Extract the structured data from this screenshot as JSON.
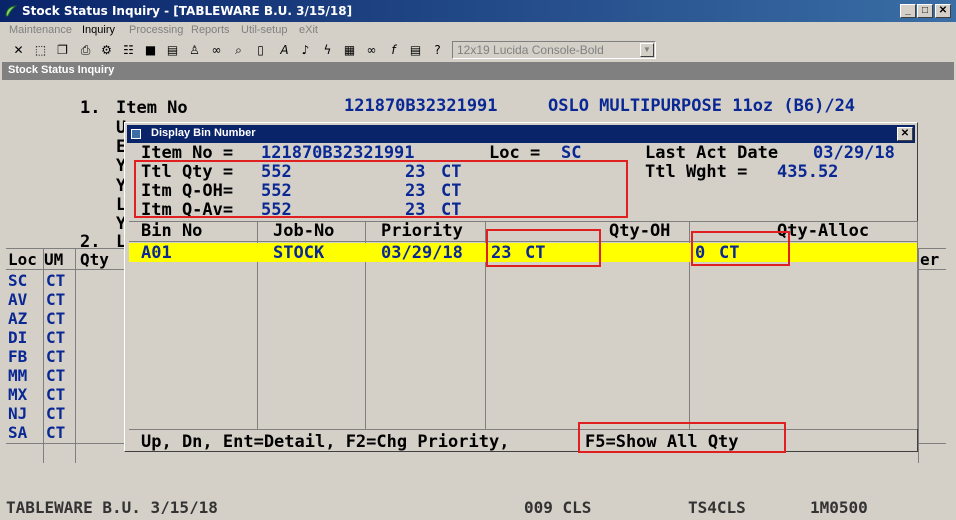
{
  "window": {
    "title": "Stock Status Inquiry - [TABLEWARE B.U. 3/15/18]",
    "minimize": "_",
    "maximize": "□",
    "close": "✕"
  },
  "menu": {
    "items": [
      {
        "label": "Maintenance",
        "enabled": false
      },
      {
        "label": "Inquiry",
        "enabled": true
      },
      {
        "label": "Processing",
        "enabled": false
      },
      {
        "label": "Reports",
        "enabled": false
      },
      {
        "label": "Util-setup",
        "enabled": false
      },
      {
        "label": "eXit",
        "enabled": false
      }
    ]
  },
  "toolbar": {
    "icons": [
      "close-icon",
      "select-icon",
      "copy-icon",
      "print-icon",
      "settings-icon",
      "options-icon",
      "stop-icon",
      "report-icon",
      "user-icon",
      "binoculars-icon",
      "search-icon",
      "bookmark-icon",
      "font-icon",
      "sound-icon",
      "lightning-icon",
      "calculator-icon",
      "link-icon",
      "function-icon",
      "note-icon",
      "help-icon"
    ],
    "font_combo": "12x19 Lucida Console-Bold"
  },
  "document": {
    "title": "Stock Status Inquiry"
  },
  "screen": {
    "item_number_label": "1.",
    "item_label": "Item No",
    "item_no": "121870B32321991",
    "item_desc": "OSLO MULTIPURPOSE 11oz (B6)/24",
    "section_2_label": "2.",
    "left_letters": [
      "U",
      "E",
      "Y",
      "Y",
      "L",
      "Y"
    ],
    "grid_headers": [
      "Loc",
      "UM",
      "Qty"
    ],
    "right_header_fragment": "er",
    "locations": [
      {
        "loc": "SC",
        "um": "CT"
      },
      {
        "loc": "AV",
        "um": "CT"
      },
      {
        "loc": "AZ",
        "um": "CT"
      },
      {
        "loc": "DI",
        "um": "CT"
      },
      {
        "loc": "FB",
        "um": "CT"
      },
      {
        "loc": "MM",
        "um": "CT"
      },
      {
        "loc": "MX",
        "um": "CT"
      },
      {
        "loc": "NJ",
        "um": "CT"
      },
      {
        "loc": "SA",
        "um": "CT"
      }
    ],
    "status_segments": [
      "TABLEWARE B.U. 3/15/18",
      "009 CLS",
      "TS4CLS",
      "1M0500"
    ]
  },
  "dialog": {
    "title": "Display Bin Number",
    "item_no_label": "Item No =",
    "item_no": "121870B32321991",
    "loc_label": "Loc =",
    "loc": "SC",
    "last_act_label": "Last Act Date",
    "last_act_date": "03/29/18",
    "ttl_wght_label": "Ttl Wght =",
    "ttl_wght": "435.52",
    "summary": [
      {
        "label": "Ttl Qty =",
        "qty": "552",
        "bin_qty": "23",
        "um": "CT"
      },
      {
        "label": "Itm Q-OH=",
        "qty": "552",
        "bin_qty": "23",
        "um": "CT"
      },
      {
        "label": "Itm Q-Av=",
        "qty": "552",
        "bin_qty": "23",
        "um": "CT"
      }
    ],
    "columns": [
      "Bin No",
      "Job-No",
      "Priority",
      "Qty-OH",
      "Qty-Alloc"
    ],
    "rows": [
      {
        "bin_no": "A01",
        "job_no": "STOCK",
        "priority": "03/29/18",
        "qty_oh": "23",
        "qty_oh_um": "CT",
        "qty_alloc": "0",
        "qty_alloc_um": "CT"
      }
    ],
    "footer": "Up, Dn, Ent=Detail, F2=Chg Priority, ",
    "footer_f5": "F5=Show All Qty",
    "close": "✕"
  },
  "colors": {
    "title_bar": "#0a246a",
    "highlight_row": "#ffff00",
    "value_blue": "#0a2894",
    "annotation_red": "#e02020"
  }
}
